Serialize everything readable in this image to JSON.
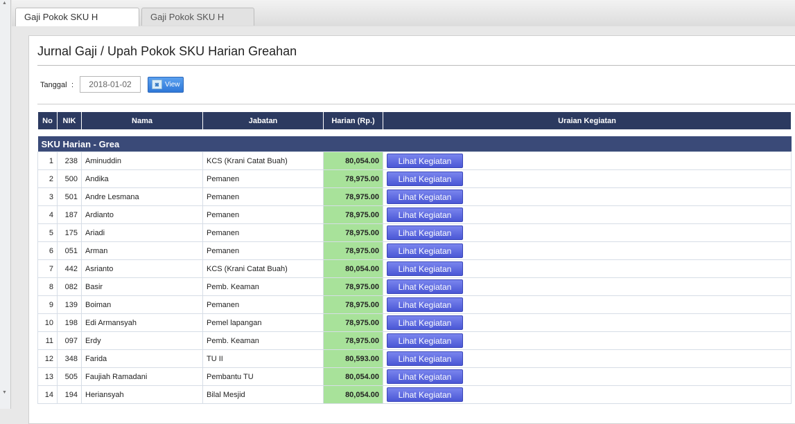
{
  "tabs": [
    {
      "label": "Gaji Pokok SKU H Greahan",
      "active": true
    },
    {
      "label": "Gaji Pokok SKU H Hevea",
      "active": false
    }
  ],
  "page": {
    "title": "Jurnal Gaji / Upah Pokok SKU Harian Greahan"
  },
  "filter": {
    "date_label": "Tanggal",
    "colon": ":",
    "date_value": "2018-01-02",
    "view_label": "View"
  },
  "table": {
    "columns": [
      "No",
      "NIK",
      "Nama",
      "Jabatan",
      "Harian (Rp.)",
      "Uraian Kegiatan"
    ],
    "group_label": "SKU Harian - Grea",
    "action_label": "Lihat Kegiatan",
    "rows": [
      {
        "no": "1",
        "nik": "238",
        "nama": "Aminuddin",
        "jabatan": "KCS (Krani Catat Buah)",
        "harian": "80,054.00"
      },
      {
        "no": "2",
        "nik": "500",
        "nama": "Andika",
        "jabatan": "Pemanen",
        "harian": "78,975.00"
      },
      {
        "no": "3",
        "nik": "501",
        "nama": "Andre Lesmana",
        "jabatan": "Pemanen",
        "harian": "78,975.00"
      },
      {
        "no": "4",
        "nik": "187",
        "nama": "Ardianto",
        "jabatan": "Pemanen",
        "harian": "78,975.00"
      },
      {
        "no": "5",
        "nik": "175",
        "nama": "Ariadi",
        "jabatan": "Pemanen",
        "harian": "78,975.00"
      },
      {
        "no": "6",
        "nik": "051",
        "nama": "Arman",
        "jabatan": "Pemanen",
        "harian": "78,975.00"
      },
      {
        "no": "7",
        "nik": "442",
        "nama": "Asrianto",
        "jabatan": "KCS (Krani Catat Buah)",
        "harian": "80,054.00"
      },
      {
        "no": "8",
        "nik": "082",
        "nama": "Basir",
        "jabatan": "Pemb. Keaman",
        "harian": "78,975.00"
      },
      {
        "no": "9",
        "nik": "139",
        "nama": "Boiman",
        "jabatan": "Pemanen",
        "harian": "78,975.00"
      },
      {
        "no": "10",
        "nik": "198",
        "nama": "Edi Armansyah",
        "jabatan": "Pemel lapangan",
        "harian": "78,975.00"
      },
      {
        "no": "11",
        "nik": "097",
        "nama": "Erdy",
        "jabatan": "Pemb. Keaman",
        "harian": "78,975.00"
      },
      {
        "no": "12",
        "nik": "348",
        "nama": "Farida",
        "jabatan": "TU II",
        "harian": "80,593.00"
      },
      {
        "no": "13",
        "nik": "505",
        "nama": "Faujiah Ramadani",
        "jabatan": "Pembantu TU",
        "harian": "80,054.00"
      },
      {
        "no": "14",
        "nik": "194",
        "nama": "Heriansyah",
        "jabatan": "Bilal Mesjid",
        "harian": "80,054.00"
      }
    ]
  }
}
